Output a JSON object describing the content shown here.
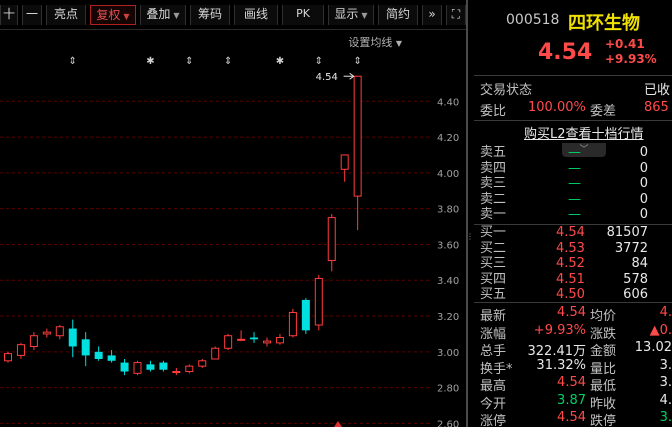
{
  "toolbar": {
    "items": [
      {
        "label": "十",
        "has_menu": false,
        "active": false
      },
      {
        "label": "一",
        "has_menu": false,
        "active": false
      },
      {
        "label": "亮点",
        "has_menu": false,
        "active": false
      },
      {
        "label": "复权",
        "has_menu": true,
        "active": true
      },
      {
        "label": "叠加",
        "has_menu": true,
        "active": false
      },
      {
        "label": "筹码",
        "has_menu": false,
        "active": false
      },
      {
        "label": "画线",
        "has_menu": false,
        "active": false
      },
      {
        "label": "PK",
        "has_menu": false,
        "active": false
      },
      {
        "label": "显示",
        "has_menu": true,
        "active": false
      },
      {
        "label": "简约",
        "has_menu": false,
        "active": false
      },
      {
        "label": "»",
        "has_menu": false,
        "active": false
      },
      {
        "label": "⛶",
        "has_menu": false,
        "active": false
      }
    ]
  },
  "chart": {
    "ma_setting_label": "设置均线",
    "markers": [
      "⇕",
      "✱",
      "⇕",
      "⇕",
      "✱",
      "⇕",
      "⇕"
    ],
    "last_price_label": "4.54",
    "colors": {
      "up": "#ff3c3c",
      "down": "#00e0e0",
      "grid": "#5a0000",
      "axis": "#a0a0a0"
    }
  },
  "chart_data": {
    "type": "candlestick",
    "ylim": [
      2.58,
      4.72
    ],
    "y_ticks": [
      "4.40",
      "4.20",
      "4.00",
      "3.80",
      "3.60",
      "3.40",
      "3.20",
      "3.00",
      "2.80",
      "2.60"
    ],
    "candles": [
      {
        "o": 2.95,
        "h": 3.0,
        "l": 2.94,
        "c": 2.99
      },
      {
        "o": 2.98,
        "h": 3.05,
        "l": 2.96,
        "c": 3.04
      },
      {
        "o": 3.03,
        "h": 3.11,
        "l": 3.01,
        "c": 3.09
      },
      {
        "o": 3.1,
        "h": 3.13,
        "l": 3.08,
        "c": 3.11
      },
      {
        "o": 3.09,
        "h": 3.15,
        "l": 3.07,
        "c": 3.14
      },
      {
        "o": 3.13,
        "h": 3.18,
        "l": 2.97,
        "c": 3.03
      },
      {
        "o": 3.07,
        "h": 3.11,
        "l": 2.92,
        "c": 2.98
      },
      {
        "o": 3.0,
        "h": 3.03,
        "l": 2.95,
        "c": 2.96
      },
      {
        "o": 2.98,
        "h": 3.01,
        "l": 2.94,
        "c": 2.95
      },
      {
        "o": 2.94,
        "h": 2.96,
        "l": 2.87,
        "c": 2.89
      },
      {
        "o": 2.88,
        "h": 2.95,
        "l": 2.87,
        "c": 2.94
      },
      {
        "o": 2.93,
        "h": 2.95,
        "l": 2.89,
        "c": 2.9
      },
      {
        "o": 2.94,
        "h": 2.95,
        "l": 2.89,
        "c": 2.9
      },
      {
        "o": 2.89,
        "h": 2.91,
        "l": 2.87,
        "c": 2.89
      },
      {
        "o": 2.89,
        "h": 2.93,
        "l": 2.88,
        "c": 2.92
      },
      {
        "o": 2.92,
        "h": 2.96,
        "l": 2.91,
        "c": 2.95
      },
      {
        "o": 2.96,
        "h": 3.03,
        "l": 2.96,
        "c": 3.02
      },
      {
        "o": 3.02,
        "h": 3.1,
        "l": 3.01,
        "c": 3.09
      },
      {
        "o": 3.07,
        "h": 3.12,
        "l": 3.06,
        "c": 3.07
      },
      {
        "o": 3.08,
        "h": 3.11,
        "l": 3.05,
        "c": 3.07
      },
      {
        "o": 3.05,
        "h": 3.08,
        "l": 3.03,
        "c": 3.06
      },
      {
        "o": 3.05,
        "h": 3.1,
        "l": 3.04,
        "c": 3.08
      },
      {
        "o": 3.09,
        "h": 3.24,
        "l": 3.08,
        "c": 3.22
      },
      {
        "o": 3.29,
        "h": 3.3,
        "l": 3.1,
        "c": 3.12
      },
      {
        "o": 3.15,
        "h": 3.43,
        "l": 3.12,
        "c": 3.41
      },
      {
        "o": 3.51,
        "h": 3.77,
        "l": 3.45,
        "c": 3.75
      },
      {
        "o": 4.02,
        "h": 4.1,
        "l": 3.95,
        "c": 4.1
      },
      {
        "o": 3.87,
        "h": 4.54,
        "l": 3.68,
        "c": 4.54
      }
    ]
  },
  "quote": {
    "code": "000518",
    "name": "四环生物",
    "price": "4.54",
    "change": "+0.41",
    "change_pct": "+9.93%",
    "trade_status_label": "交易状态",
    "trade_status_value": "已收",
    "weibi_label": "委比",
    "weibi_value": "100.00%",
    "weicha_label": "委差",
    "weicha_value": "865",
    "l2_link": "购买L2查看十档行情",
    "asks": [
      {
        "label": "卖五",
        "price": "—",
        "vol": "0"
      },
      {
        "label": "卖四",
        "price": "—",
        "vol": "0"
      },
      {
        "label": "卖三",
        "price": "—",
        "vol": "0"
      },
      {
        "label": "卖二",
        "price": "—",
        "vol": "0"
      },
      {
        "label": "卖一",
        "price": "—",
        "vol": "0"
      }
    ],
    "bids": [
      {
        "label": "买一",
        "price": "4.54",
        "vol": "81507"
      },
      {
        "label": "买二",
        "price": "4.53",
        "vol": "3772"
      },
      {
        "label": "买三",
        "price": "4.52",
        "vol": "84"
      },
      {
        "label": "买四",
        "price": "4.51",
        "vol": "578"
      },
      {
        "label": "买五",
        "price": "4.50",
        "vol": "606"
      }
    ],
    "stats": [
      {
        "l1": "最新",
        "v1": "4.54",
        "c1": "red",
        "l2": "均价",
        "v2": "4.",
        "c2": "red"
      },
      {
        "l1": "涨幅",
        "v1": "+9.93%",
        "c1": "red",
        "l2": "涨跌",
        "v2": "▲0.",
        "c2": "red"
      },
      {
        "l1": "总手",
        "v1": "322.41万",
        "c1": "white",
        "l2": "金额",
        "v2": "13.02",
        "c2": "white"
      },
      {
        "l1": "换手*",
        "v1": "31.32%",
        "c1": "white",
        "l2": "量比",
        "v2": "3.",
        "c2": "white"
      },
      {
        "l1": "最高",
        "v1": "4.54",
        "c1": "red",
        "l2": "最低",
        "v2": "3.",
        "c2": "white"
      },
      {
        "l1": "今开",
        "v1": "3.87",
        "c1": "green",
        "l2": "昨收",
        "v2": "4.",
        "c2": "white"
      },
      {
        "l1": "涨停",
        "v1": "4.54",
        "c1": "red",
        "l2": "跌停",
        "v2": "3.",
        "c2": "green"
      }
    ]
  }
}
